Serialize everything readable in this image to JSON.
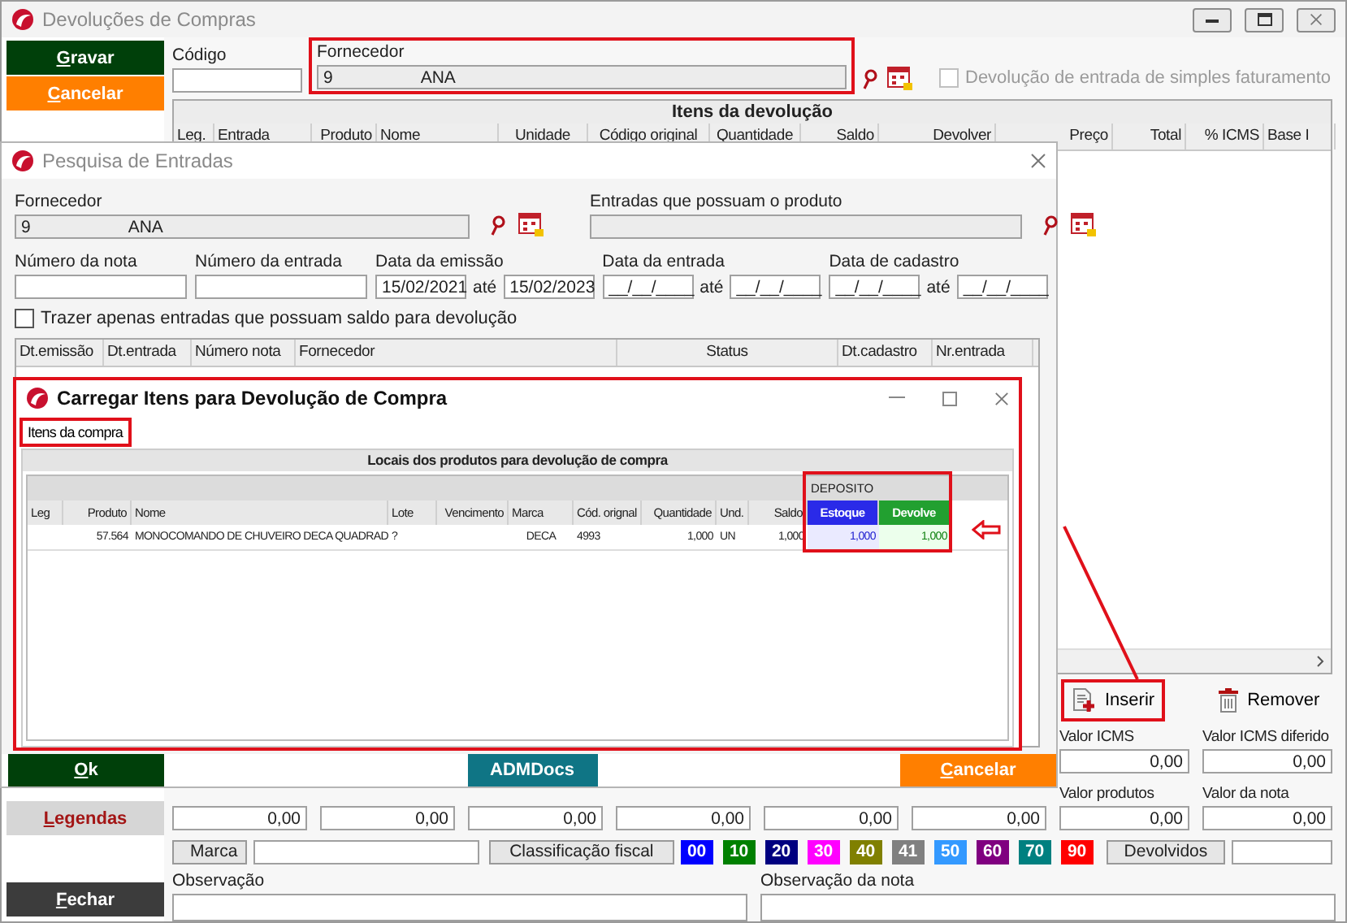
{
  "main_window": {
    "title": "Devoluções de Compras",
    "side_buttons": [
      {
        "label": "Gravar",
        "kind": "save"
      },
      {
        "label": "Cancelar",
        "kind": "cancel"
      },
      {
        "label": "Legendas",
        "kind": "legend"
      },
      {
        "label": "Fechar",
        "kind": "close"
      }
    ],
    "code_field": {
      "label": "Código"
    },
    "supplier": {
      "label": "Fornecedor",
      "code": "9",
      "name": "ANA",
      "highlighted": true
    },
    "simple_billing": {
      "label": "Devolução de entrada de simples faturamento",
      "checked": false,
      "disabled": true
    },
    "items_table": {
      "title": "Itens da devolução",
      "columns": [
        "Leg.",
        "Entrada",
        "Produto",
        "Nome",
        "Unidade",
        "Código original",
        "Quantidade",
        "Saldo",
        "Devolver",
        "Preço",
        "Total",
        "% ICMS",
        "Base I"
      ]
    },
    "actions": [
      {
        "label": "Inserir",
        "kind": "insert",
        "highlighted": true
      },
      {
        "label": "Remover",
        "kind": "remove",
        "highlighted": false
      }
    ],
    "totals_top": [
      {
        "label": "Valor ICMS",
        "value": "0,00"
      },
      {
        "label": "Valor ICMS diferido",
        "value": "0,00"
      }
    ],
    "totals_bottom": [
      {
        "value": "0,00"
      },
      {
        "value": "0,00"
      },
      {
        "value": "0,00"
      },
      {
        "value": "0,00"
      },
      {
        "value": "0,00"
      },
      {
        "value": "0,00"
      },
      {
        "label": "Valor produtos",
        "value": "0,00"
      },
      {
        "label": "Valor da nota",
        "value": "0,00"
      }
    ],
    "brand": {
      "label": "Marca"
    },
    "fiscal_class": {
      "label": "Classificação fiscal",
      "codes": [
        {
          "code": "00",
          "color": "#0000ff"
        },
        {
          "code": "10",
          "color": "#008000"
        },
        {
          "code": "20",
          "color": "#000080"
        },
        {
          "code": "30",
          "color": "#ff00ff"
        },
        {
          "code": "40",
          "color": "#808000"
        },
        {
          "code": "41",
          "color": "#808080"
        },
        {
          "code": "50",
          "color": "#3399ff"
        },
        {
          "code": "60",
          "color": "#800080"
        },
        {
          "code": "70",
          "color": "#008080"
        },
        {
          "code": "90",
          "color": "#ff0000"
        }
      ]
    },
    "returned": {
      "label": "Devolvidos"
    },
    "notes": [
      {
        "label": "Observação"
      },
      {
        "label": "Observação da nota"
      }
    ]
  },
  "search_dialog": {
    "title": "Pesquisa de Entradas",
    "supplier": {
      "label": "Fornecedor",
      "code": "9",
      "name": "ANA"
    },
    "product": {
      "label": "Entradas que possuam o produto"
    },
    "filters": [
      {
        "label": "Número da nota",
        "kind": "text"
      },
      {
        "label": "Número da entrada",
        "kind": "text"
      },
      {
        "label": "Data da emissão",
        "kind": "range",
        "from": "15/02/2021",
        "separator": "até",
        "to": "15/02/2023"
      },
      {
        "label": "Data da entrada",
        "kind": "range",
        "from": "__/__/____",
        "separator": "até",
        "to": "__/__/____"
      },
      {
        "label": "Data de cadastro",
        "kind": "range",
        "from": "__/__/____",
        "separator": "até",
        "to": "__/__/____"
      }
    ],
    "only_with_balance": {
      "label": "Trazer apenas entradas que possuam saldo para devolução",
      "checked": false
    },
    "columns": [
      "Dt.emissão",
      "Dt.entrada",
      "Número nota",
      "Fornecedor",
      "Status",
      "Dt.cadastro",
      "Nr.entrada"
    ],
    "footer_buttons": [
      {
        "label": "Ok",
        "kind": "ok",
        "mnemonic": true
      },
      {
        "label": "ADMDocs",
        "kind": "docs",
        "mnemonic": false
      },
      {
        "label": "Cancelar",
        "kind": "cancel",
        "mnemonic": true
      }
    ]
  },
  "load_dialog": {
    "title": "Carregar Itens para Devolução de Compra",
    "highlighted": true,
    "tabs": [
      {
        "label": "Itens da compra",
        "selected": true,
        "highlighted": true
      }
    ],
    "panel_title": "Locais dos produtos para devolução de compra",
    "group_header": {
      "label": "DEPOSITO",
      "highlighted": true
    },
    "columns": [
      {
        "label": "Leg",
        "kind": "plain"
      },
      {
        "label": "Produto",
        "kind": "plain"
      },
      {
        "label": "Nome",
        "kind": "plain"
      },
      {
        "label": "Lote",
        "kind": "plain"
      },
      {
        "label": "Vencimento",
        "kind": "plain"
      },
      {
        "label": "Marca",
        "kind": "plain"
      },
      {
        "label": "Cód. orignal",
        "kind": "plain"
      },
      {
        "label": "Quantidade",
        "kind": "plain"
      },
      {
        "label": "Und.",
        "kind": "plain"
      },
      {
        "label": "Saldo",
        "kind": "plain"
      },
      {
        "label": "Estoque",
        "kind": "stock"
      },
      {
        "label": "Devolve",
        "kind": "return"
      }
    ],
    "rows": [
      {
        "cells": [
          null,
          "57.564",
          "MONOCOMANDO DE CHUVEIRO DECA QUADRAD",
          "?",
          null,
          "DECA",
          "4993",
          "1,000",
          "UN",
          "1,000",
          "1,000",
          "1,000"
        ]
      }
    ]
  }
}
